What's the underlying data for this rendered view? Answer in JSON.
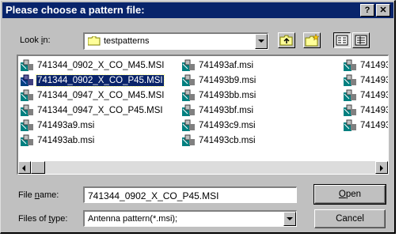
{
  "window": {
    "title": "Please choose a pattern file:",
    "help_glyph": "?",
    "close_glyph": "✕"
  },
  "lookin": {
    "label_pre": "Look ",
    "label_ul": "i",
    "label_post": "n:",
    "value": "testpatterns",
    "folder_icon": "folder-icon"
  },
  "toolbar": {
    "up_icon": "up-one-level-icon",
    "new_folder_icon": "new-folder-icon",
    "list_icon": "list-view-icon",
    "details_icon": "details-view-icon"
  },
  "files": {
    "col1": [
      {
        "name": "741344_0902_X_CO_M45.MSI",
        "selected": false
      },
      {
        "name": "741344_0902_X_CO_P45.MSI",
        "selected": true
      },
      {
        "name": "741344_0947_X_CO_M45.MSI",
        "selected": false
      },
      {
        "name": "741344_0947_X_CO_P45.MSI",
        "selected": false
      },
      {
        "name": "741493a9.msi",
        "selected": false
      },
      {
        "name": "741493ab.msi",
        "selected": false
      }
    ],
    "col2": [
      {
        "name": "741493af.msi"
      },
      {
        "name": "741493b9.msi"
      },
      {
        "name": "741493bb.msi"
      },
      {
        "name": "741493bf.msi"
      },
      {
        "name": "741493c9.msi"
      },
      {
        "name": "741493cb.msi"
      }
    ],
    "col3": [
      {
        "name": "741493"
      },
      {
        "name": "741493"
      },
      {
        "name": "741493"
      },
      {
        "name": "741493"
      },
      {
        "name": "741493"
      }
    ]
  },
  "filename": {
    "label_pre": "File ",
    "label_ul": "n",
    "label_post": "ame:",
    "value": "741344_0902_X_CO_P45.MSI"
  },
  "filetype": {
    "label_pre": "Files of ",
    "label_ul": "t",
    "label_post": "ype:",
    "value": "Antenna pattern(*.msi);"
  },
  "buttons": {
    "open_ul": "O",
    "open_rest": "pen",
    "cancel": "Cancel"
  }
}
